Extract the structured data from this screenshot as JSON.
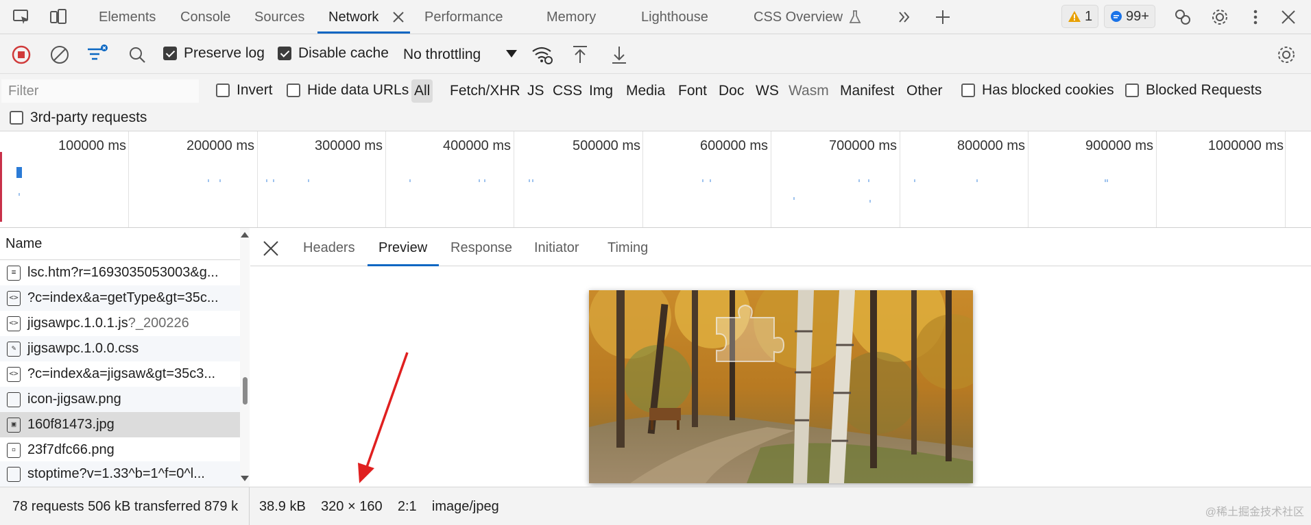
{
  "tabbar": {
    "tabs": [
      {
        "label": "Elements"
      },
      {
        "label": "Console"
      },
      {
        "label": "Sources"
      },
      {
        "label": "Network"
      },
      {
        "label": "Performance"
      },
      {
        "label": "Memory"
      },
      {
        "label": "Lighthouse"
      },
      {
        "label": "CSS Overview"
      }
    ],
    "active_tab": "Network",
    "warning_count": "1",
    "message_count": "99+"
  },
  "toolbar": {
    "preserve_log_label": "Preserve log",
    "preserve_log_checked": true,
    "disable_cache_label": "Disable cache",
    "disable_cache_checked": true,
    "throttling_value": "No throttling"
  },
  "filterbar": {
    "filter_placeholder": "Filter",
    "invert_label": "Invert",
    "hide_data_urls_label": "Hide data URLs",
    "types": [
      "All",
      "Fetch/XHR",
      "JS",
      "CSS",
      "Img",
      "Media",
      "Font",
      "Doc",
      "WS",
      "Wasm",
      "Manifest",
      "Other"
    ],
    "active_type": "All",
    "has_blocked_cookies_label": "Has blocked cookies",
    "blocked_requests_label": "Blocked Requests",
    "third_party_label": "3rd-party requests"
  },
  "overview": {
    "ticks": [
      "100000 ms",
      "200000 ms",
      "300000 ms",
      "400000 ms",
      "500000 ms",
      "600000 ms",
      "700000 ms",
      "800000 ms",
      "900000 ms",
      "1000000 ms"
    ]
  },
  "requests": {
    "header": "Name",
    "rows": [
      {
        "name": "lsc.htm?r=1693035053003&g...",
        "icon": "document-icon",
        "muted": ""
      },
      {
        "name": "?c=index&a=getType&gt=35c...",
        "icon": "script-icon",
        "muted": ""
      },
      {
        "name": "jigsawpc.1.0.1.js",
        "icon": "script-icon",
        "muted": "?_200226"
      },
      {
        "name": "jigsawpc.1.0.0.css",
        "icon": "stylesheet-icon",
        "muted": ""
      },
      {
        "name": "?c=index&a=jigsaw&gt=35c3...",
        "icon": "script-icon",
        "muted": ""
      },
      {
        "name": "icon-jigsaw.png",
        "icon": "file-icon",
        "muted": ""
      },
      {
        "name": "160f81473.jpg",
        "icon": "image-icon",
        "muted": ""
      },
      {
        "name": "23f7dfc66.png",
        "icon": "image-icon",
        "muted": ""
      },
      {
        "name": "stoptime?v=1.33^b=1^f=0^l...",
        "icon": "file-icon",
        "muted": ""
      }
    ],
    "selected_index": 6
  },
  "detail": {
    "tabs": [
      "Headers",
      "Preview",
      "Response",
      "Initiator",
      "Timing"
    ],
    "active_tab": "Preview"
  },
  "status": {
    "left": "78 requests   506 kB transferred   879 k",
    "size": "38.9 kB",
    "dimensions": "320 × 160",
    "ratio": "2:1",
    "mime": "image/jpeg",
    "watermark": "@稀土掘金技术社区"
  },
  "colors": {
    "accent": "#0a66c2",
    "record": "#d03a3a",
    "warning": "#e8a000",
    "message": "#1a73e8",
    "annotation_arrow": "#e02020"
  }
}
